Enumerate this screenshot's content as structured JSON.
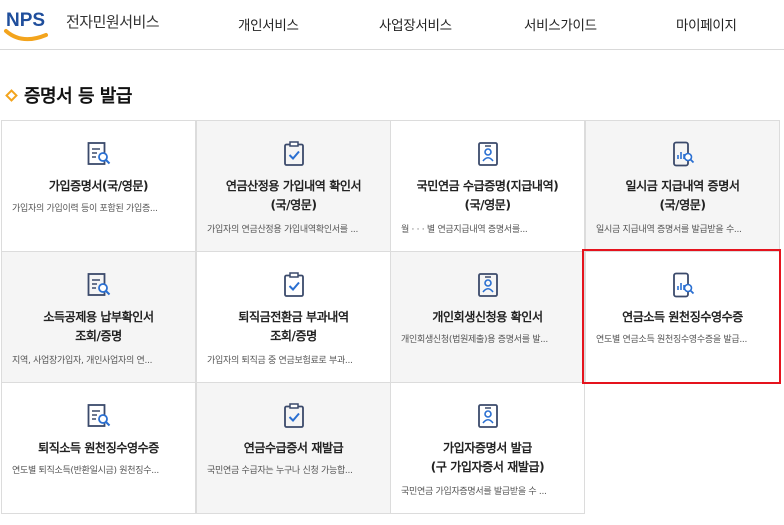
{
  "brand": {
    "logo_text": "NPS",
    "service_name": "전자민원서비스"
  },
  "nav": [
    "개인서비스",
    "사업장서비스",
    "서비스가이드",
    "마이페이지"
  ],
  "section_title": "증명서 등 발급",
  "cards": [
    {
      "icon": "document-search-icon",
      "title": "가입증명서(국/영문)",
      "desc": "가입자의 가입이력 등이 포함된 가입증..."
    },
    {
      "icon": "clipboard-check-icon",
      "title": "연금산정용 가입내역 확인서 (국/영문)",
      "desc": "가입자의 연금산정용 가입내역확인서를 ..."
    },
    {
      "icon": "person-id-icon",
      "title": "국민연금 수급증명(지급내역) (국/영문)",
      "desc": "월 · · · 별 연금지급내역 증명서를..."
    },
    {
      "icon": "mobile-chart-icon",
      "title": "일시금 지급내역 증명서 (국/영문)",
      "desc": "일시금 지급내역 증명서를 발급받을 수..."
    },
    {
      "icon": "document-search-icon",
      "title": "소득공제용 납부확인서 조회/증명",
      "desc": "지역, 사업장가입자, 개인사업자의 연..."
    },
    {
      "icon": "clipboard-check-icon",
      "title": "퇴직금전환금 부과내역 조회/증명",
      "desc": "가입자의 퇴직금 중 연금보험료로 부과..."
    },
    {
      "icon": "person-id-icon",
      "title": "개인회생신청용 확인서",
      "desc": "개인회생신청(법원제출)용 증명서를 발..."
    },
    {
      "icon": "mobile-chart-icon",
      "title": "연금소득 원천징수영수증",
      "desc": "연도별 연금소득 원천징수영수증을 발급..."
    },
    {
      "icon": "document-search-icon",
      "title": "퇴직소득 원천징수영수증",
      "desc": "연도별 퇴직소득(반환일시금) 원천징수..."
    },
    {
      "icon": "clipboard-check-icon",
      "title": "연금수급증서 재발급",
      "desc": "국민연금 수급자는 누구나 신청 가능합..."
    },
    {
      "icon": "person-id-icon",
      "title": "가입자증명서 발급 (구 가입자증서 재발급)",
      "desc": "국민연금 가입자증명서를 발급받을 수 ..."
    }
  ],
  "card_lines": [
    [
      "가입증명서(국/영문)"
    ],
    [
      "연금산정용 가입내역 확인서",
      "(국/영문)"
    ],
    [
      "국민연금 수급증명(지급내역)",
      "(국/영문)"
    ],
    [
      "일시금 지급내역 증명서",
      "(국/영문)"
    ],
    [
      "소득공제용 납부확인서",
      "조회/증명"
    ],
    [
      "퇴직금전환금 부과내역",
      "조회/증명"
    ],
    [
      "개인회생신청용 확인서"
    ],
    [
      "연금소득 원천징수영수증"
    ],
    [
      "퇴직소득 원천징수영수증"
    ],
    [
      "연금수급증서 재발급"
    ],
    [
      "가입자증명서 발급",
      "(구 가입자증서 재발급)"
    ]
  ],
  "colors": {
    "brand_blue": "#1f4e9c",
    "brand_orange": "#f3a41d",
    "highlight_red": "#e5131d",
    "icon_navy": "#3b4a6b"
  }
}
